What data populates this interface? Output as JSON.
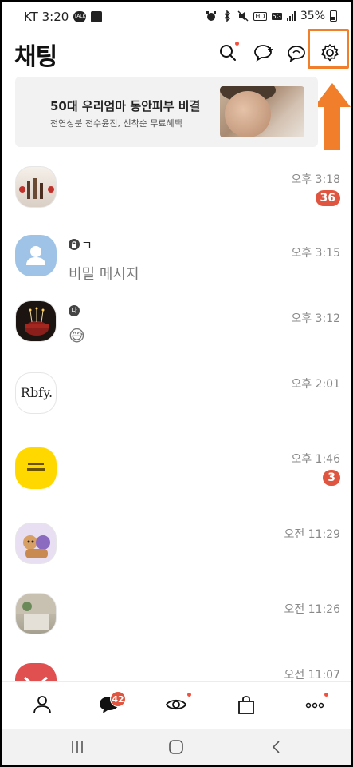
{
  "status_bar": {
    "carrier_time": "KT 3:20",
    "talk_badge": "TALK",
    "hd": "HD",
    "lte": "5G",
    "battery": "35%"
  },
  "header": {
    "title": "채팅"
  },
  "ad": {
    "title": "50대 우리엄마 동안피부 비결",
    "subtitle": "천연성분 천수윤진, 선착순 무료혜택"
  },
  "chats": [
    {
      "name": "",
      "message": "",
      "time": "오후 3:18",
      "unread": "36"
    },
    {
      "name": "ㄱ",
      "message": "비밀 메시지",
      "time": "오후 3:15",
      "unread": ""
    },
    {
      "name": "",
      "message": "😅",
      "time": "오후 3:12",
      "unread": "",
      "badge": "나"
    },
    {
      "name": "",
      "message": "",
      "time": "오후 2:01",
      "unread": "",
      "avatar_text": "Rbfy."
    },
    {
      "name": "",
      "message": "",
      "time": "오후 1:46",
      "unread": "3"
    },
    {
      "name": "",
      "message": "",
      "time": "오전 11:29",
      "unread": ""
    },
    {
      "name": "",
      "message": "",
      "time": "오전 11:26",
      "unread": ""
    },
    {
      "name": "",
      "message": "",
      "time": "오전 11:07",
      "unread": ""
    }
  ],
  "bottom_nav": {
    "chat_badge": "42"
  },
  "colors": {
    "accent": "#e0553f",
    "highlight": "#f07e2a"
  }
}
